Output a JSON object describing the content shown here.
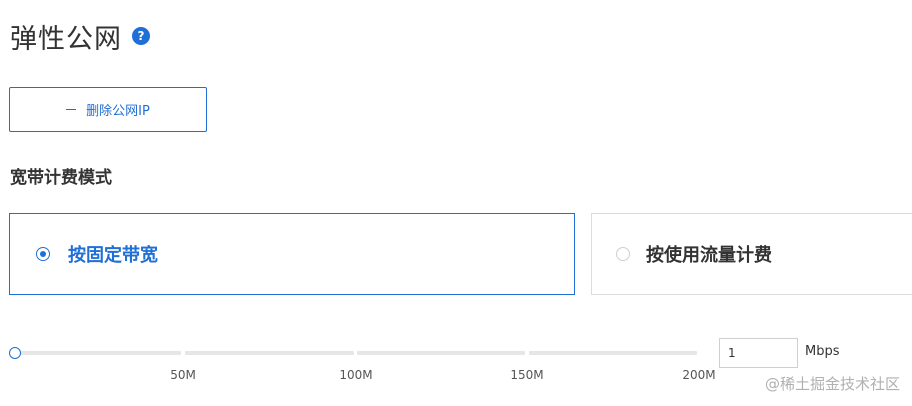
{
  "header": {
    "title": "弹性公网",
    "help_glyph": "?"
  },
  "actions": {
    "remove_ip_label": "删除公网IP"
  },
  "billing": {
    "section_label": "宽带计费模式",
    "options": [
      {
        "label": "按固定带宽",
        "selected": true
      },
      {
        "label": "按使用流量计费",
        "selected": false
      }
    ]
  },
  "bandwidth": {
    "value": "1",
    "unit": "Mbps",
    "min": 0,
    "max": 200,
    "current": 1,
    "ticks": [
      "50M",
      "100M",
      "150M",
      "200M"
    ]
  },
  "watermark": "@稀土掘金技术社区",
  "colors": {
    "accent": "#1f6fd6",
    "border": "#dcdcdc",
    "track": "#e6e6e6"
  },
  "icons": [
    "help-icon",
    "minus-icon"
  ]
}
